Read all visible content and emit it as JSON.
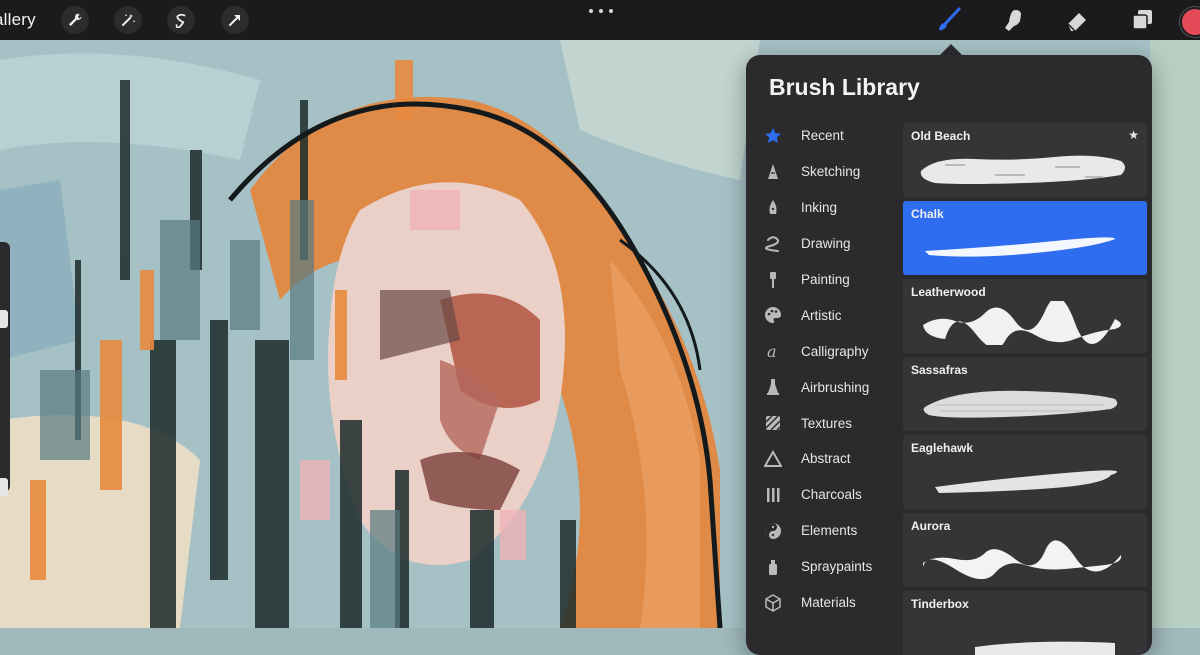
{
  "toolbar": {
    "gallery_label": "allery",
    "left_tools": [
      {
        "name": "actions-wrench-icon"
      },
      {
        "name": "adjustments-wand-icon"
      },
      {
        "name": "selection-s-icon"
      },
      {
        "name": "transform-arrow-icon"
      }
    ],
    "right_tools": [
      {
        "name": "brush-icon",
        "active": true
      },
      {
        "name": "smudge-icon"
      },
      {
        "name": "eraser-icon"
      },
      {
        "name": "layers-icon"
      }
    ],
    "current_color": "#e24a57",
    "accent_color": "#2f6df0"
  },
  "brush_library": {
    "title": "Brush Library",
    "categories": [
      {
        "label": "Recent",
        "icon": "star-icon"
      },
      {
        "label": "Sketching",
        "icon": "pencil-tip-icon"
      },
      {
        "label": "Inking",
        "icon": "ink-nib-icon"
      },
      {
        "label": "Drawing",
        "icon": "squiggle-icon"
      },
      {
        "label": "Painting",
        "icon": "paintbrush-icon"
      },
      {
        "label": "Artistic",
        "icon": "palette-icon"
      },
      {
        "label": "Calligraphy",
        "icon": "calligraphy-a-icon"
      },
      {
        "label": "Airbrushing",
        "icon": "airbrush-icon"
      },
      {
        "label": "Textures",
        "icon": "texture-hatch-icon"
      },
      {
        "label": "Abstract",
        "icon": "triangle-icon"
      },
      {
        "label": "Charcoals",
        "icon": "charcoal-bars-icon"
      },
      {
        "label": "Elements",
        "icon": "yin-yang-icon"
      },
      {
        "label": "Spraypaints",
        "icon": "spraycan-icon"
      },
      {
        "label": "Materials",
        "icon": "cube-icon"
      }
    ],
    "brushes": [
      {
        "name": "Old Beach",
        "favorite": true,
        "selected": false
      },
      {
        "name": "Chalk",
        "favorite": false,
        "selected": true
      },
      {
        "name": "Leatherwood",
        "favorite": false,
        "selected": false
      },
      {
        "name": "Sassafras",
        "favorite": false,
        "selected": false
      },
      {
        "name": "Eaglehawk",
        "favorite": false,
        "selected": false
      },
      {
        "name": "Aurora",
        "favorite": false,
        "selected": false
      },
      {
        "name": "Tinderbox",
        "favorite": false,
        "selected": false
      }
    ],
    "favorite_mark": "★"
  }
}
